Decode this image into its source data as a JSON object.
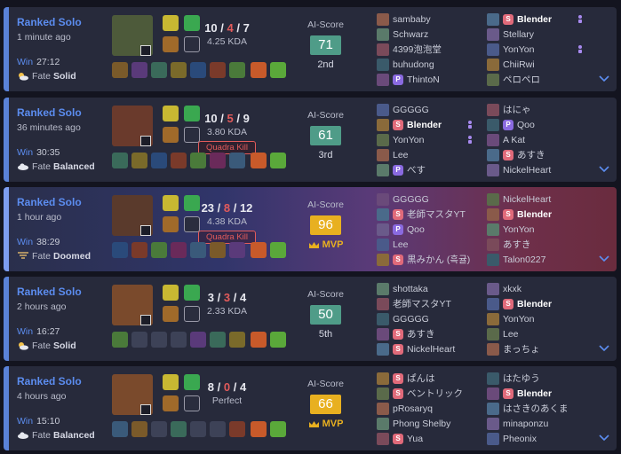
{
  "matches": [
    {
      "queue": "Ranked Solo",
      "ago": "1 minute ago",
      "result": "Win",
      "duration": "27:12",
      "fate_label": "Fate",
      "fate": "Solid",
      "fate_icon": "sun-cloud-icon",
      "kills": "10",
      "deaths": "4",
      "assists": "7",
      "ratio": "4.25 KDA",
      "multikill": "",
      "ai_label": "AI-Score",
      "ai_score": "71",
      "placement": "2nd",
      "mvp": false,
      "champ_color": "#4d5a3a",
      "items_empty": [],
      "team1": [
        {
          "name": "sambaby",
          "tag": "",
          "self": false,
          "duo": false
        },
        {
          "name": "Schwarz",
          "tag": "",
          "self": false,
          "duo": false
        },
        {
          "name": "4399泡泡堂",
          "tag": "",
          "self": false,
          "duo": false
        },
        {
          "name": "buhudong",
          "tag": "",
          "self": false,
          "duo": false
        },
        {
          "name": "ThintoN",
          "tag": "P",
          "self": false,
          "duo": false
        }
      ],
      "team2": [
        {
          "name": "Blender",
          "tag": "S",
          "self": true,
          "duo": true
        },
        {
          "name": "Stellary",
          "tag": "",
          "self": false,
          "duo": false
        },
        {
          "name": "YonYon",
          "tag": "",
          "self": false,
          "duo": true
        },
        {
          "name": "ChiiRwi",
          "tag": "",
          "self": false,
          "duo": false
        },
        {
          "name": "ペロペロ",
          "tag": "",
          "self": false,
          "duo": false
        }
      ]
    },
    {
      "queue": "Ranked Solo",
      "ago": "36 minutes ago",
      "result": "Win",
      "duration": "30:35",
      "fate_label": "Fate",
      "fate": "Balanced",
      "fate_icon": "cloud-icon",
      "kills": "10",
      "deaths": "5",
      "assists": "9",
      "ratio": "3.80 KDA",
      "multikill": "Quadra Kill",
      "ai_label": "AI-Score",
      "ai_score": "61",
      "placement": "3rd",
      "mvp": false,
      "champ_color": "#6a3a2c",
      "items_empty": [],
      "team1": [
        {
          "name": "GGGGG",
          "tag": "",
          "self": false,
          "duo": false
        },
        {
          "name": "Blender",
          "tag": "S",
          "self": true,
          "duo": true
        },
        {
          "name": "YonYon",
          "tag": "",
          "self": false,
          "duo": true
        },
        {
          "name": "Lee",
          "tag": "",
          "self": false,
          "duo": false
        },
        {
          "name": "べす",
          "tag": "P",
          "self": false,
          "duo": false
        }
      ],
      "team2": [
        {
          "name": "はにゃ",
          "tag": "",
          "self": false,
          "duo": false
        },
        {
          "name": "Qoo",
          "tag": "P",
          "self": false,
          "duo": false
        },
        {
          "name": "A Kat",
          "tag": "",
          "self": false,
          "duo": false
        },
        {
          "name": "あすき",
          "tag": "S",
          "self": false,
          "duo": false
        },
        {
          "name": "NickelHeart",
          "tag": "",
          "self": false,
          "duo": false
        }
      ]
    },
    {
      "queue": "Ranked Solo",
      "ago": "1 hour ago",
      "result": "Win",
      "duration": "38:29",
      "fate_label": "Fate",
      "fate": "Doomed",
      "fate_icon": "tornado-icon",
      "kills": "23",
      "deaths": "8",
      "assists": "12",
      "ratio": "4.38 KDA",
      "multikill": "Quadra Kill",
      "ai_label": "AI-Score",
      "ai_score": "96",
      "placement": "MVP",
      "mvp": true,
      "champ_color": "#5a3a2c",
      "items_empty": [],
      "team1": [
        {
          "name": "GGGGG",
          "tag": "",
          "self": false,
          "duo": false
        },
        {
          "name": "老師マスタYT",
          "tag": "S",
          "self": false,
          "duo": false
        },
        {
          "name": "Qoo",
          "tag": "P",
          "self": false,
          "duo": false
        },
        {
          "name": "Lee",
          "tag": "",
          "self": false,
          "duo": false
        },
        {
          "name": "黒みかん (흑귤)",
          "tag": "S",
          "self": false,
          "duo": false
        }
      ],
      "team2": [
        {
          "name": "NickelHeart",
          "tag": "",
          "self": false,
          "duo": false
        },
        {
          "name": "Blender",
          "tag": "S",
          "self": true,
          "duo": false
        },
        {
          "name": "YonYon",
          "tag": "",
          "self": false,
          "duo": false
        },
        {
          "name": "あすき",
          "tag": "",
          "self": false,
          "duo": false
        },
        {
          "name": "Talon0227",
          "tag": "",
          "self": false,
          "duo": false
        }
      ]
    },
    {
      "queue": "Ranked Solo",
      "ago": "2 hours ago",
      "result": "Win",
      "duration": "16:27",
      "fate_label": "Fate",
      "fate": "Solid",
      "fate_icon": "sun-cloud-icon",
      "kills": "3",
      "deaths": "3",
      "assists": "4",
      "ratio": "2.33 KDA",
      "multikill": "",
      "ai_label": "AI-Score",
      "ai_score": "50",
      "placement": "5th",
      "mvp": false,
      "champ_color": "#7a4a2c",
      "items_empty": [
        1,
        2,
        3
      ],
      "team1": [
        {
          "name": "shottaka",
          "tag": "",
          "self": false,
          "duo": false
        },
        {
          "name": "老師マスタYT",
          "tag": "",
          "self": false,
          "duo": false
        },
        {
          "name": "GGGGG",
          "tag": "",
          "self": false,
          "duo": false
        },
        {
          "name": "あすき",
          "tag": "S",
          "self": false,
          "duo": false
        },
        {
          "name": "NickelHeart",
          "tag": "S",
          "self": false,
          "duo": false
        }
      ],
      "team2": [
        {
          "name": "xkxk",
          "tag": "",
          "self": false,
          "duo": false
        },
        {
          "name": "Blender",
          "tag": "S",
          "self": true,
          "duo": false
        },
        {
          "name": "YonYon",
          "tag": "",
          "self": false,
          "duo": false
        },
        {
          "name": "Lee",
          "tag": "",
          "self": false,
          "duo": false
        },
        {
          "name": "まっちょ",
          "tag": "",
          "self": false,
          "duo": false
        }
      ]
    },
    {
      "queue": "Ranked Solo",
      "ago": "4 hours ago",
      "result": "Win",
      "duration": "15:10",
      "fate_label": "Fate",
      "fate": "Balanced",
      "fate_icon": "cloud-icon",
      "kills": "8",
      "deaths": "0",
      "assists": "4",
      "ratio": "Perfect",
      "multikill": "",
      "ai_label": "AI-Score",
      "ai_score": "66",
      "placement": "MVP",
      "mvp": true,
      "champ_color": "#7a4a2c",
      "items_empty": [
        2,
        4,
        5
      ],
      "team1": [
        {
          "name": "ぱんは",
          "tag": "S",
          "self": false,
          "duo": false
        },
        {
          "name": "ベントリック",
          "tag": "S",
          "self": false,
          "duo": false
        },
        {
          "name": "pRosaryq",
          "tag": "",
          "self": false,
          "duo": false
        },
        {
          "name": "Phong Shelby",
          "tag": "",
          "self": false,
          "duo": false
        },
        {
          "name": "Yua",
          "tag": "S",
          "self": false,
          "duo": false
        }
      ],
      "team2": [
        {
          "name": "はたゆう",
          "tag": "",
          "self": false,
          "duo": false
        },
        {
          "name": "Blender",
          "tag": "S",
          "self": true,
          "duo": false
        },
        {
          "name": "はさきのあくま",
          "tag": "",
          "self": false,
          "duo": false
        },
        {
          "name": "minaponzu",
          "tag": "",
          "self": false,
          "duo": false
        },
        {
          "name": "Pheonix",
          "tag": "",
          "self": false,
          "duo": false
        }
      ]
    }
  ],
  "colors": {
    "accent": "#5c8df0",
    "death": "#e35b5b",
    "score": "#4f9c88",
    "mvp": "#e8b020",
    "duo": "#a88af0",
    "sTag": "#e06a7a",
    "pTag": "#8a6ae0"
  },
  "item_palette": [
    "#7a5a2a",
    "#5a3a7a",
    "#3a6a5a",
    "#7a6a2a",
    "#2a4a7a",
    "#7a3a2a",
    "#4a7a3a",
    "#6a2a5a",
    "#3a5a7a"
  ],
  "pic_palette": [
    "#8a5a4a",
    "#4a5a8a",
    "#6a4a7a",
    "#5a7a6a",
    "#8a6a3a",
    "#4a6a8a",
    "#7a4a5a",
    "#5a6a4a",
    "#6a5a8a",
    "#3a5a6a"
  ]
}
